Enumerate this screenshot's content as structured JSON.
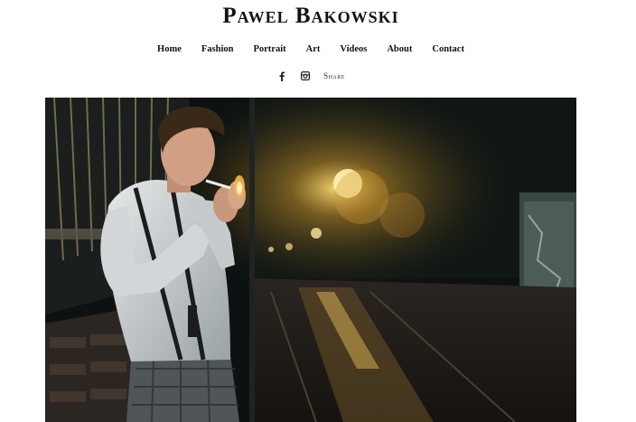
{
  "site": {
    "title": "Pawel Bakowski"
  },
  "nav": {
    "items": [
      {
        "label": "Home"
      },
      {
        "label": "Fashion"
      },
      {
        "label": "Portrait"
      },
      {
        "label": "Art"
      },
      {
        "label": "Videos"
      },
      {
        "label": "About"
      },
      {
        "label": "Contact"
      }
    ]
  },
  "social": {
    "facebook_icon": "facebook-icon",
    "instagram_icon": "instagram-icon",
    "share_label": "Share"
  },
  "hero": {
    "icon": "photo-man-lighting-cigarette-night-street"
  }
}
